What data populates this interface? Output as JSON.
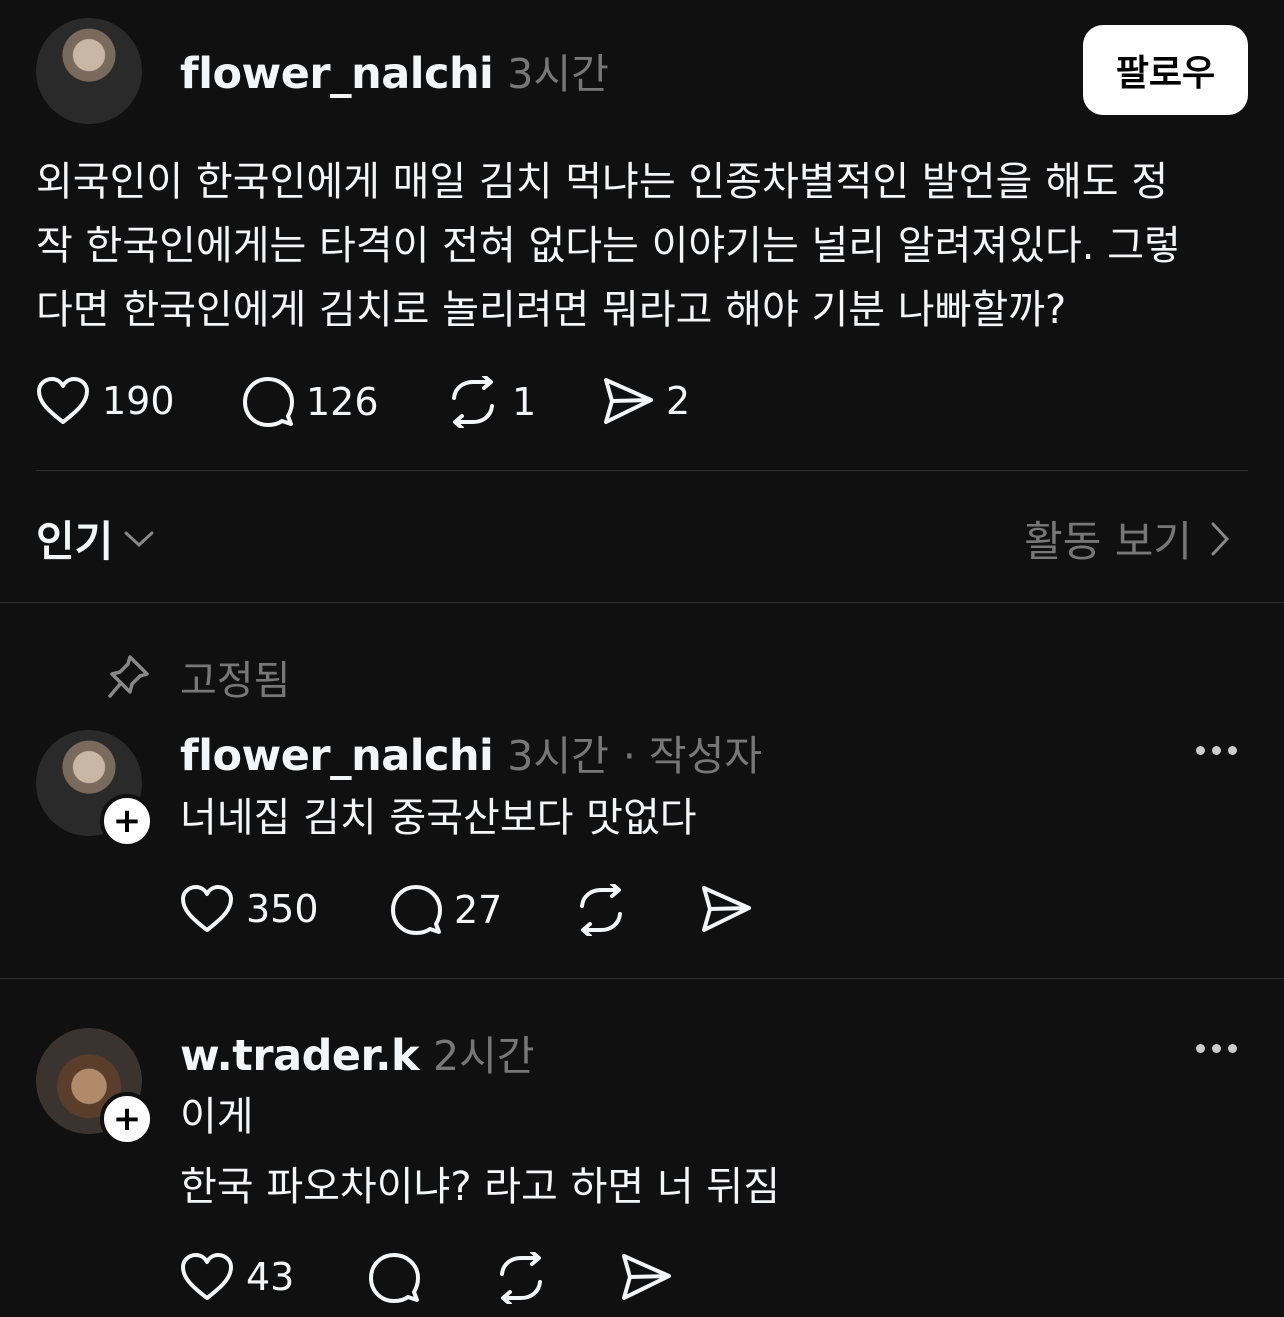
{
  "post": {
    "author": "flower_nalchi",
    "time": "3시간",
    "follow_label": "팔로우",
    "text_lines": [
      "외국인이 한국인에게 매일 김치 먹냐는 인종차별적인 발언을 해도 정",
      "작 한국인에게는 타격이 전혀 없다는 이야기는 널리 알려져있다. 그렇",
      "다면 한국인에게 김치로 놀리려면 뭐라고 해야 기분 나빠할까?"
    ],
    "likes": "190",
    "replies": "126",
    "reposts": "1",
    "shares": "2"
  },
  "sort": {
    "label": "인기",
    "activity_label": "활동 보기"
  },
  "pinned_label": "고정됨",
  "comments": [
    {
      "author": "flower_nalchi",
      "time": "3시간",
      "author_tag": "· 작성자",
      "text_lines": [
        "너네집 김치 중국산보다 맛없다"
      ],
      "likes": "350",
      "replies": "27"
    },
    {
      "author": "w.trader.k",
      "time": "2시간",
      "text_lines": [
        "이게",
        "한국 파오차이냐? 라고 하면 너 뒤짐"
      ],
      "likes": "43"
    }
  ],
  "icons": {
    "like": "heart-icon",
    "reply": "speech-bubble-icon",
    "repost": "repost-icon",
    "share": "send-icon",
    "pin": "pin-icon",
    "more": "more-icon",
    "chevron_down": "chevron-down-icon",
    "chevron_right": "chevron-right-icon"
  }
}
